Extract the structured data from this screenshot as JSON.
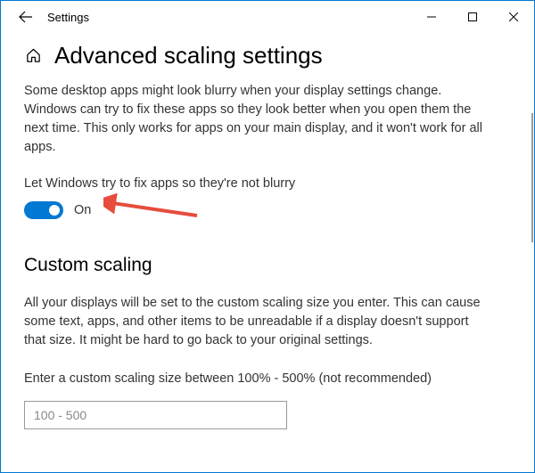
{
  "titlebar": {
    "title": "Settings"
  },
  "page": {
    "title": "Advanced scaling settings",
    "blurry_description": "Some desktop apps might look blurry when your display settings change. Windows can try to fix these apps so they look better when you open them the next time. This only works for apps on your main display, and it won't work for all apps.",
    "toggle_label": "Let Windows try to fix apps so they're not blurry",
    "toggle_state": "On",
    "custom_scaling_heading": "Custom scaling",
    "custom_scaling_description": "All your displays will be set to the custom scaling size you enter. This can cause some text, apps, and other items to be unreadable if a display doesn't support that size. It might be hard to go back to your original settings.",
    "input_label": "Enter a custom scaling size between 100% - 500% (not recommended)",
    "input_placeholder": "100 - 500"
  }
}
